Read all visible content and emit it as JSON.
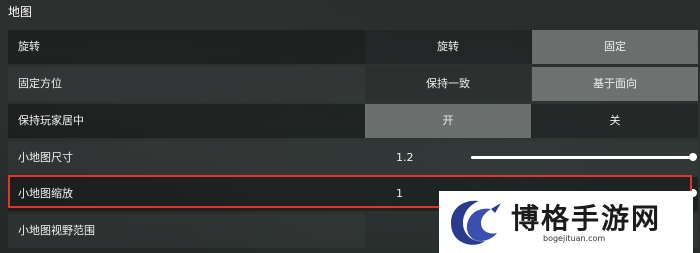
{
  "section": {
    "title": "地图"
  },
  "rows": [
    {
      "label": "旋转",
      "options": [
        "旋转",
        "固定"
      ],
      "selected": 0
    },
    {
      "label": "固定方位",
      "options": [
        "保持一致",
        "基于面向"
      ],
      "selected": 0
    },
    {
      "label": "保持玩家居中",
      "options": [
        "开",
        "关"
      ],
      "selected": 0
    },
    {
      "label": "小地图尺寸",
      "value": "1.2",
      "slider_level": 1.0
    },
    {
      "label": "小地图缩放",
      "value": "1",
      "slider_level": 1.0
    },
    {
      "label": "小地图视野范围"
    }
  ],
  "watermark": {
    "text": "博格手游网",
    "url": "bogejituan.com",
    "logo_icon": "bird-logo-icon",
    "brand_color": "#2a3a8c"
  },
  "highlight_color": "#e1352b"
}
